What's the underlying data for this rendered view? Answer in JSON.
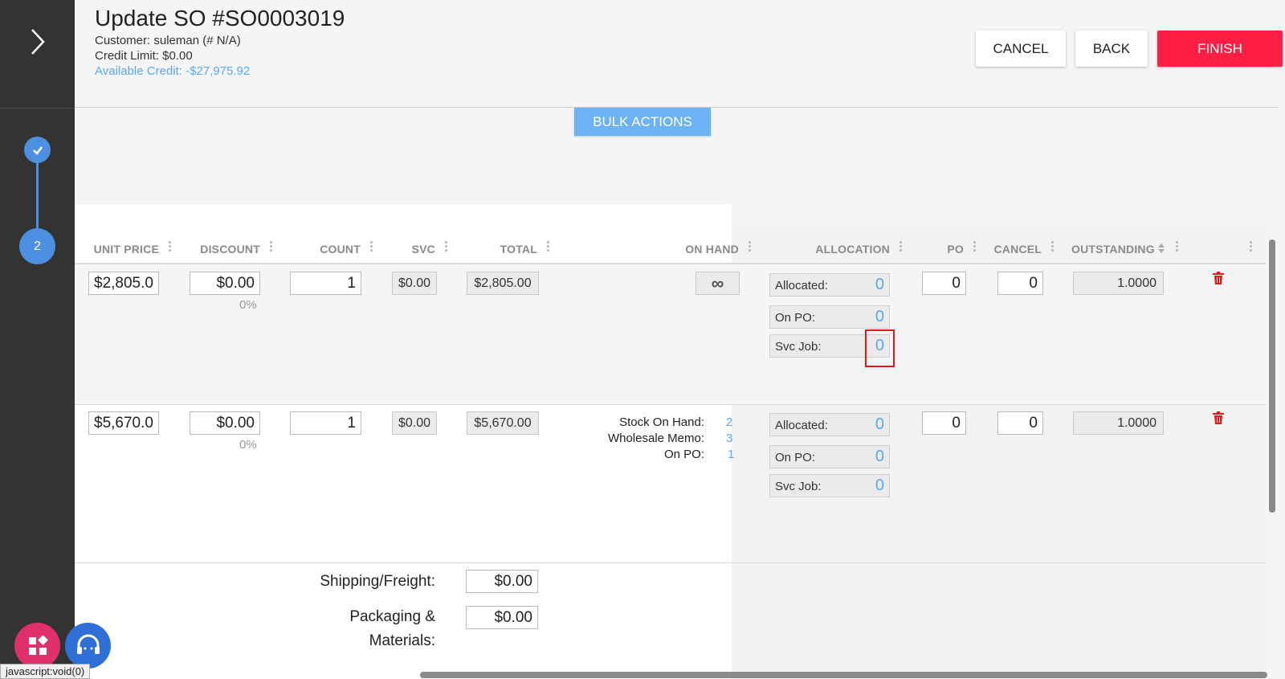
{
  "header": {
    "title": "Update SO #SO0003019",
    "customer": "Customer: suleman (# N/A)",
    "credit_limit": "Credit Limit: $0.00",
    "available_credit": "Available Credit: -$27,975.92",
    "cancel_label": "CANCEL",
    "back_label": "BACK",
    "finish_label": "FINISH"
  },
  "steps": {
    "current": "2"
  },
  "bulk_actions_label": "BULK ACTIONS",
  "columns": [
    "UNIT PRICE",
    "DISCOUNT",
    "COUNT",
    "SVC",
    "TOTAL",
    "ON HAND",
    "ALLOCATION",
    "PO",
    "CANCEL",
    "OUTSTANDING"
  ],
  "rows": [
    {
      "unit_price": "$2,805.0",
      "discount": "$0.00",
      "discount_pct": "0%",
      "count": "1",
      "svc": "$0.00",
      "total": "$2,805.00",
      "on_hand": "∞",
      "allocated_label": "Allocated:",
      "allocated": "0",
      "on_po_label": "On PO:",
      "on_po": "0",
      "svc_job_label": "Svc Job:",
      "svc_job": "0",
      "po": "0",
      "cancel": "0",
      "outstanding": "1.0000"
    },
    {
      "unit_price": "$5,670.0",
      "discount": "$0.00",
      "discount_pct": "0%",
      "count": "1",
      "svc": "$0.00",
      "total": "$5,670.00",
      "stock_on_hand_label": "Stock On Hand:",
      "stock_on_hand": "2",
      "wholesale_memo_label": "Wholesale Memo:",
      "wholesale_memo": "3",
      "on_po_stock_label": "On PO:",
      "on_po_stock": "1",
      "allocated_label": "Allocated:",
      "allocated": "0",
      "on_po_label": "On PO:",
      "on_po": "0",
      "svc_job_label": "Svc Job:",
      "svc_job": "0",
      "po": "0",
      "cancel": "0",
      "outstanding": "1.0000"
    }
  ],
  "footer": {
    "shipping_label": "Shipping/Freight:",
    "shipping_value": "$0.00",
    "packaging_label_1": "Packaging &",
    "packaging_label_2": "Materials:",
    "packaging_value": "$0.00"
  },
  "status_url": "javascript:void(0)",
  "colors": {
    "accent": "#4d8fe0",
    "finish": "#ff1f45",
    "link": "#5aa8f0",
    "rail": "#333333"
  }
}
